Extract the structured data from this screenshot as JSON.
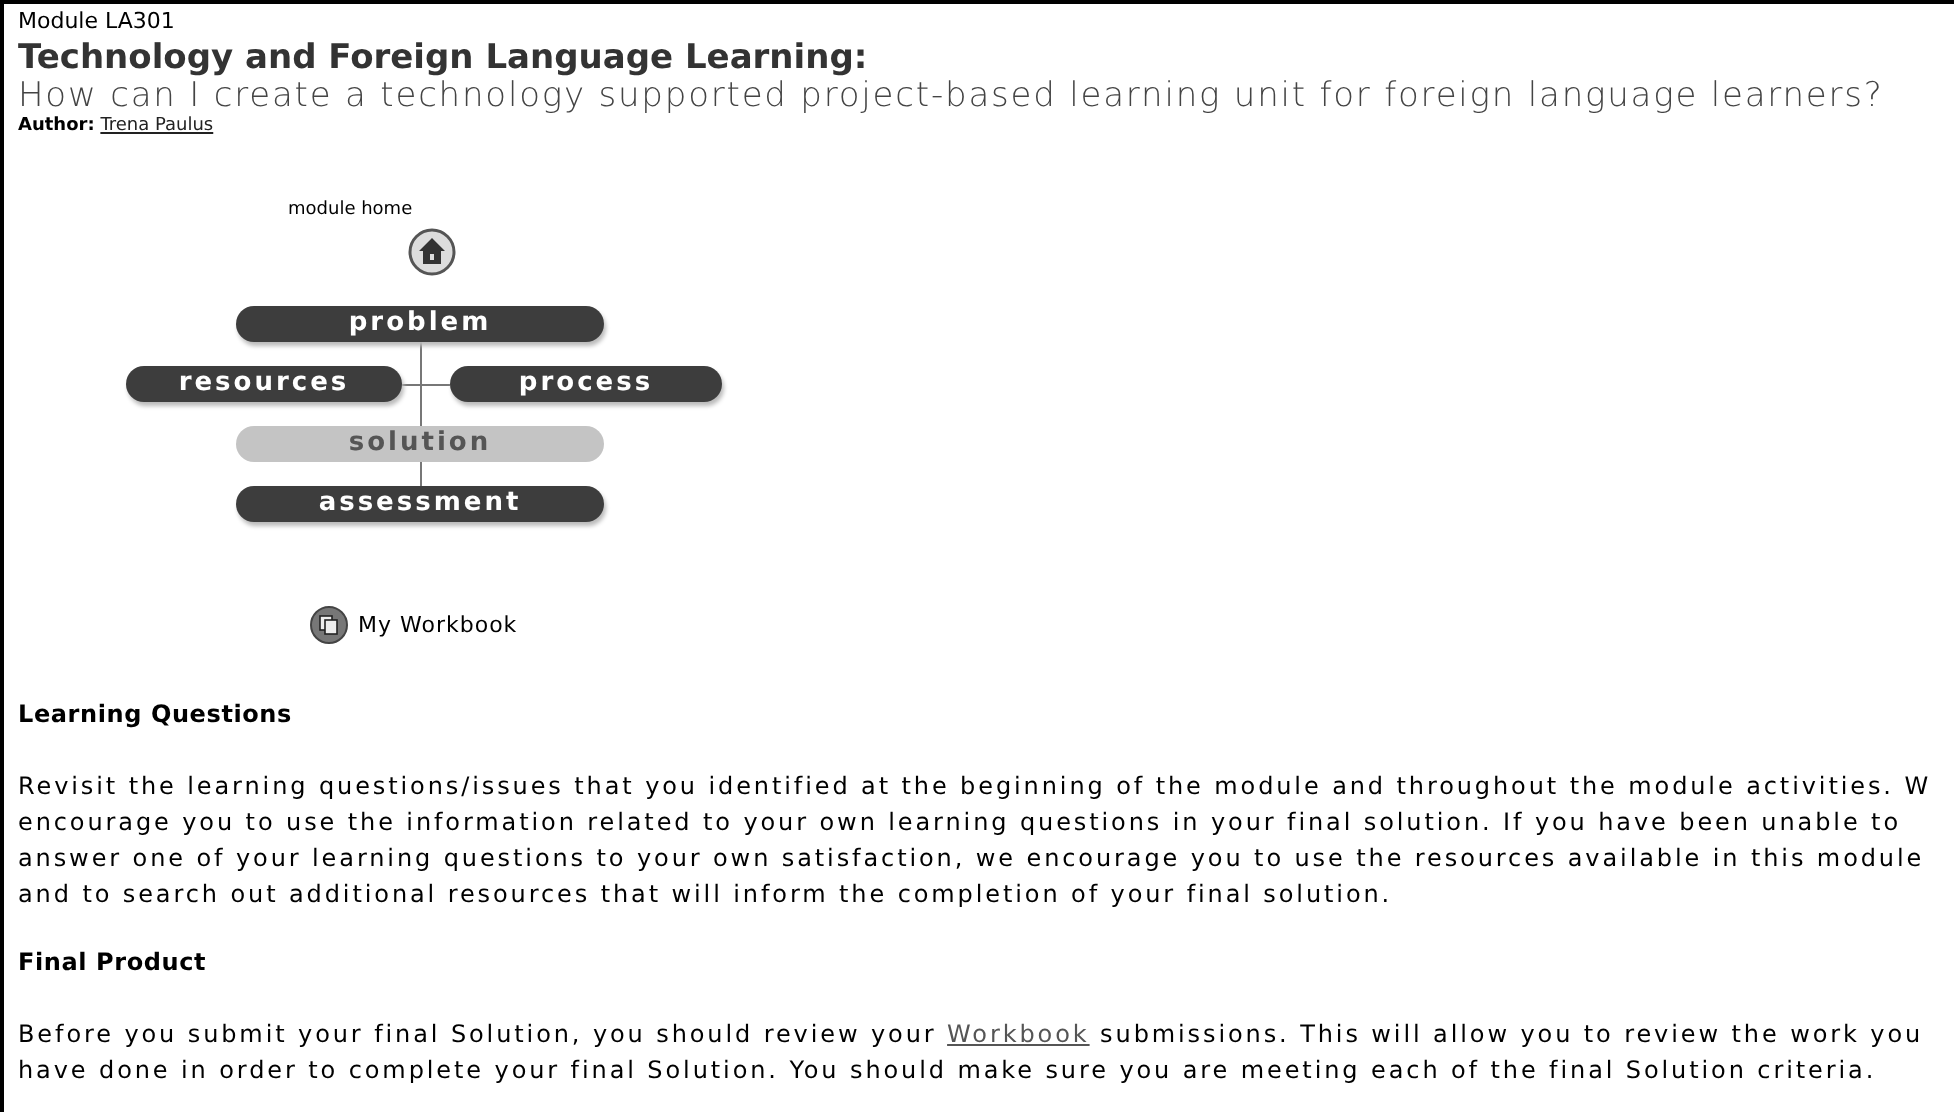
{
  "module_code": "Module LA301",
  "title": "Technology and Foreign Language Learning:",
  "subtitle": "How can I create a technology supported project-based learning unit for foreign language learners?",
  "author": {
    "label": "Author:",
    "name": "Trena Paulus"
  },
  "nav": {
    "home_label": "module home",
    "nodes": [
      {
        "label": "problem",
        "kind": "center",
        "selected": false
      },
      {
        "label": "resources",
        "kind": "left",
        "selected": false
      },
      {
        "label": "process",
        "kind": "right",
        "selected": false
      },
      {
        "label": "solution",
        "kind": "center",
        "selected": true
      },
      {
        "label": "assessment",
        "kind": "center",
        "selected": false
      }
    ],
    "workbook": "My Workbook"
  },
  "sections": [
    {
      "heading": "Learning Questions",
      "lines": [
        "Revisit the learning questions/issues that you identified at the beginning of the module and throughout the module activities. W",
        "encourage you to use the information related to your own learning questions in your final solution. If you have been unable to",
        "answer one of your learning questions to your own satisfaction, we encourage you to use the resources available in this module",
        "and to search out additional resources that will inform the completion of your final solution."
      ]
    },
    {
      "heading": "Final Product",
      "lines": [
        [
          {
            "text": "Before you submit your final Solution, you should review your "
          },
          {
            "text": "Workbook",
            "kind": "link"
          },
          {
            "text": " submissions. This will allow you to review the work you"
          }
        ],
        "have done in order to complete your final Solution. You should make sure you are meeting each of the final Solution criteria."
      ]
    }
  ]
}
